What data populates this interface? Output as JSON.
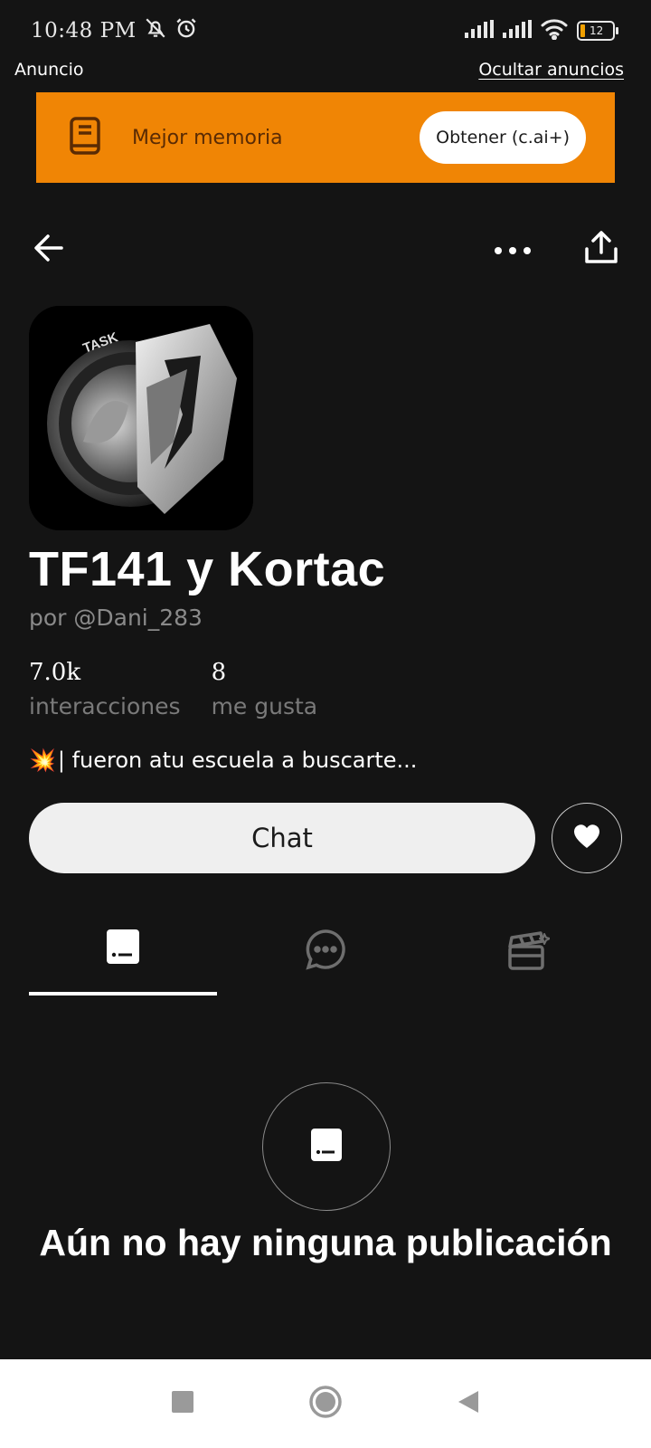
{
  "status_bar": {
    "time": "10:48 PM",
    "battery": "12"
  },
  "ad": {
    "label": "Anuncio",
    "hide_link": "Ocultar anuncios",
    "banner_text": "Mejor memoria",
    "banner_button": "Obtener (c.ai+)",
    "banner_color": "#f08505"
  },
  "character": {
    "name": "TF141 y Kortac",
    "author": "por @Dani_283",
    "description": "| fueron atu escuela a buscarte...",
    "description_emoji": "💥"
  },
  "stats": [
    {
      "value": "7.0k",
      "label": "interacciones"
    },
    {
      "value": "8",
      "label": "me gusta"
    }
  ],
  "actions": {
    "chat_label": "Chat"
  },
  "tabs": [
    {
      "icon": "post-icon",
      "active": true
    },
    {
      "icon": "chat-bubble-icon",
      "active": false
    },
    {
      "icon": "clapperboard-icon",
      "active": false
    }
  ],
  "empty_state": {
    "message": "Aún no hay ninguna publicación"
  }
}
